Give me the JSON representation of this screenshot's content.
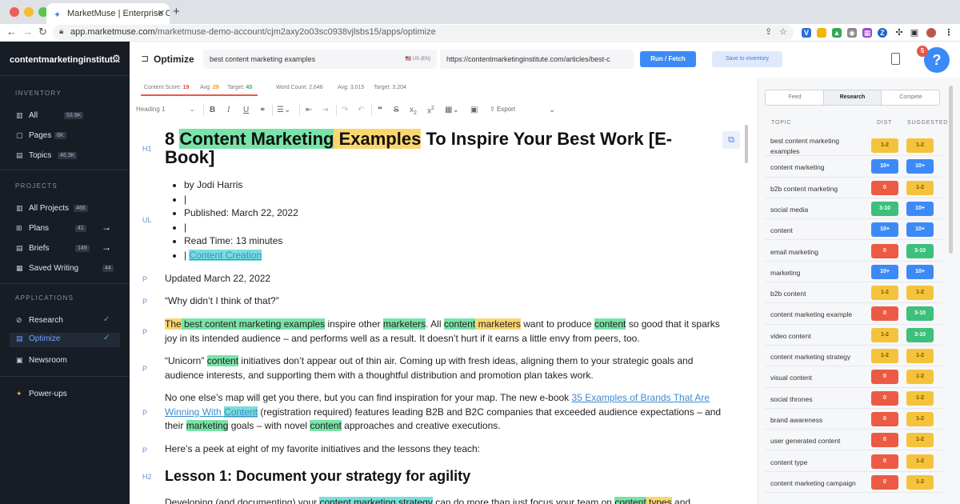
{
  "browser": {
    "tab_title": "MarketMuse | Enterprise Cont",
    "url_host": "app.marketmuse.com",
    "url_path": "/marketmuse-demo-account/cjm2axy2o03sc0938vjlsbs15/apps/optimize",
    "traffic_colors": [
      "#ec5f57",
      "#f4bd2f",
      "#5ac64b"
    ]
  },
  "sidebar": {
    "account": "contentmarketinginstitut...",
    "sections": {
      "inventory": "INVENTORY",
      "projects": "PROJECTS",
      "applications": "APPLICATIONS"
    },
    "inventory": [
      {
        "label": "All",
        "count": "53.9K",
        "icon": "bars-icon"
      },
      {
        "label": "Pages",
        "count": "6K",
        "icon": "pages-icon"
      },
      {
        "label": "Topics",
        "count": "46.3K",
        "icon": "topics-icon"
      }
    ],
    "projects": [
      {
        "label": "All Projects",
        "count": "466",
        "icon": "bars-icon"
      },
      {
        "label": "Plans",
        "count": "41",
        "icon": "plans-icon"
      },
      {
        "label": "Briefs",
        "count": "149",
        "icon": "briefs-icon"
      },
      {
        "label": "Saved Writing",
        "count": "44",
        "icon": "writing-icon"
      }
    ],
    "applications": [
      {
        "label": "Research",
        "icon": "research-icon"
      },
      {
        "label": "Optimize",
        "icon": "optimize-icon"
      },
      {
        "label": "Newsroom",
        "icon": "newsroom-icon"
      }
    ],
    "powerups": "Power-ups"
  },
  "appbar": {
    "title": "Optimize",
    "keyword": "best content marketing examples",
    "locale": "US (EN)",
    "url": "https://contentmarketinginstitute.com/articles/best-c",
    "run_label": "Run / Fetch",
    "save_label": "Save to inventory",
    "notifications": "5",
    "help": "?"
  },
  "scores": {
    "content_score_label": "Content Score:",
    "content_score": "19",
    "avg_label": "Avg:",
    "avg": "29",
    "target_label": "Target:",
    "target": "43",
    "word_count_label": "Word Count:",
    "word_count": "2,646",
    "word_avg_label": "Avg:",
    "word_avg": "3,015",
    "word_target_label": "Target:",
    "word_target": "3,204"
  },
  "editor_toolbar": {
    "heading": "Heading 1",
    "export": "Export"
  },
  "article": {
    "h1_pre": "8 ",
    "h1_hl1": "Content Marketing",
    "h1_hl2": " Examples",
    "h1_post": " To Inspire Your Best Work [E-Book]",
    "byline": [
      "by Jodi Harris",
      "|",
      "Published: March 22, 2022",
      "|",
      "Read Time: 13 minutes"
    ],
    "category": "Content Creation",
    "updated": "Updated March 22, 2022",
    "quote": "“Why didn’t I think of that?”",
    "p1_t1": "The",
    "p1_t2": " best content marketing examples",
    "p1_t3": " inspire other ",
    "p1_t4": "marketers",
    "p1_t5": ". All ",
    "p1_t6": "content",
    "p1_t7": " marketers",
    "p1_t8": " want to produce ",
    "p1_t9": "content",
    "p1_t10": " so good that it sparks joy in its intended audience – and performs well as a result. It doesn’t hurt if it earns a little envy from peers, too.",
    "p2_t1": "“Unicorn” ",
    "p2_t2": "content",
    "p2_t3": " initiatives don’t appear out of thin air. Coming up with fresh ideas, aligning them to your strategic goals and audience interests, and supporting them with a thoughtful distribution and promotion plan takes work.",
    "p3_t1": "No one else’s map will get you there, but you can find inspiration for your map. The new e-book ",
    "p3_link1": "35 Examples of Brands That Are Winning With ",
    "p3_link2": "Content",
    "p3_t2": " (registration required) features leading B2B and B2C companies that exceeded audience expectations – and their ",
    "p3_t3": "marketing",
    "p3_t4": " goals – with novel ",
    "p3_t5": "content",
    "p3_t6": " approaches and creative executions.",
    "p4": "Here’s a peek at eight of my favorite initiatives and the lessons they teach:",
    "h2": "Lesson 1: Document your strategy for agility",
    "p5_t1": "Developing (and documenting) your ",
    "p5_t2": "content marketing strategy",
    "p5_t3": " can do more than just focus your team on ",
    "p5_t4": "content",
    "p5_t5": " types",
    "p5_t6": " and",
    "labels": [
      "H1",
      "UL",
      "P",
      "P",
      "P",
      "P",
      "P",
      "P",
      "H2"
    ]
  },
  "research_panel": {
    "tabs": [
      "Feed",
      "Research",
      "Compete"
    ],
    "col_topic": "TOPIC",
    "col_dist": "DIST",
    "col_suggested": "SUGGESTED",
    "rows": [
      {
        "topic": "best content marketing examples",
        "dist": "1-2",
        "dist_color": "yellow",
        "sugg": "1-2",
        "sugg_color": "yellow"
      },
      {
        "topic": "content marketing",
        "dist": "10+",
        "dist_color": "blue",
        "sugg": "10+",
        "sugg_color": "blue"
      },
      {
        "topic": "b2b content marketing",
        "dist": "0",
        "dist_color": "red",
        "sugg": "1-2",
        "sugg_color": "yellow"
      },
      {
        "topic": "social media",
        "dist": "3-10",
        "dist_color": "green",
        "sugg": "10+",
        "sugg_color": "blue"
      },
      {
        "topic": "content",
        "dist": "10+",
        "dist_color": "blue",
        "sugg": "10+",
        "sugg_color": "blue"
      },
      {
        "topic": "email marketing",
        "dist": "0",
        "dist_color": "red",
        "sugg": "3-10",
        "sugg_color": "green"
      },
      {
        "topic": "marketing",
        "dist": "10+",
        "dist_color": "blue",
        "sugg": "10+",
        "sugg_color": "blue"
      },
      {
        "topic": "b2b content",
        "dist": "1-2",
        "dist_color": "yellow",
        "sugg": "1-2",
        "sugg_color": "yellow"
      },
      {
        "topic": "content marketing example",
        "dist": "0",
        "dist_color": "red",
        "sugg": "3-10",
        "sugg_color": "green"
      },
      {
        "topic": "video content",
        "dist": "1-2",
        "dist_color": "yellow",
        "sugg": "3-10",
        "sugg_color": "green"
      },
      {
        "topic": "content marketing strategy",
        "dist": "1-2",
        "dist_color": "yellow",
        "sugg": "1-2",
        "sugg_color": "yellow"
      },
      {
        "topic": "visual content",
        "dist": "0",
        "dist_color": "red",
        "sugg": "1-2",
        "sugg_color": "yellow"
      },
      {
        "topic": "social thrones",
        "dist": "0",
        "dist_color": "red",
        "sugg": "1-2",
        "sugg_color": "yellow"
      },
      {
        "topic": "brand awareness",
        "dist": "0",
        "dist_color": "red",
        "sugg": "1-2",
        "sugg_color": "yellow"
      },
      {
        "topic": "user generated content",
        "dist": "0",
        "dist_color": "red",
        "sugg": "1-2",
        "sugg_color": "yellow"
      },
      {
        "topic": "content type",
        "dist": "0",
        "dist_color": "red",
        "sugg": "1-2",
        "sugg_color": "yellow"
      },
      {
        "topic": "content marketing campaign",
        "dist": "0",
        "dist_color": "red",
        "sugg": "1-2",
        "sugg_color": "yellow"
      }
    ]
  },
  "colors": {
    "nav_bg": "#171c25",
    "accent": "#3d8af7",
    "highlight_green": "#79e3a8",
    "highlight_yellow": "#fbd66e"
  }
}
